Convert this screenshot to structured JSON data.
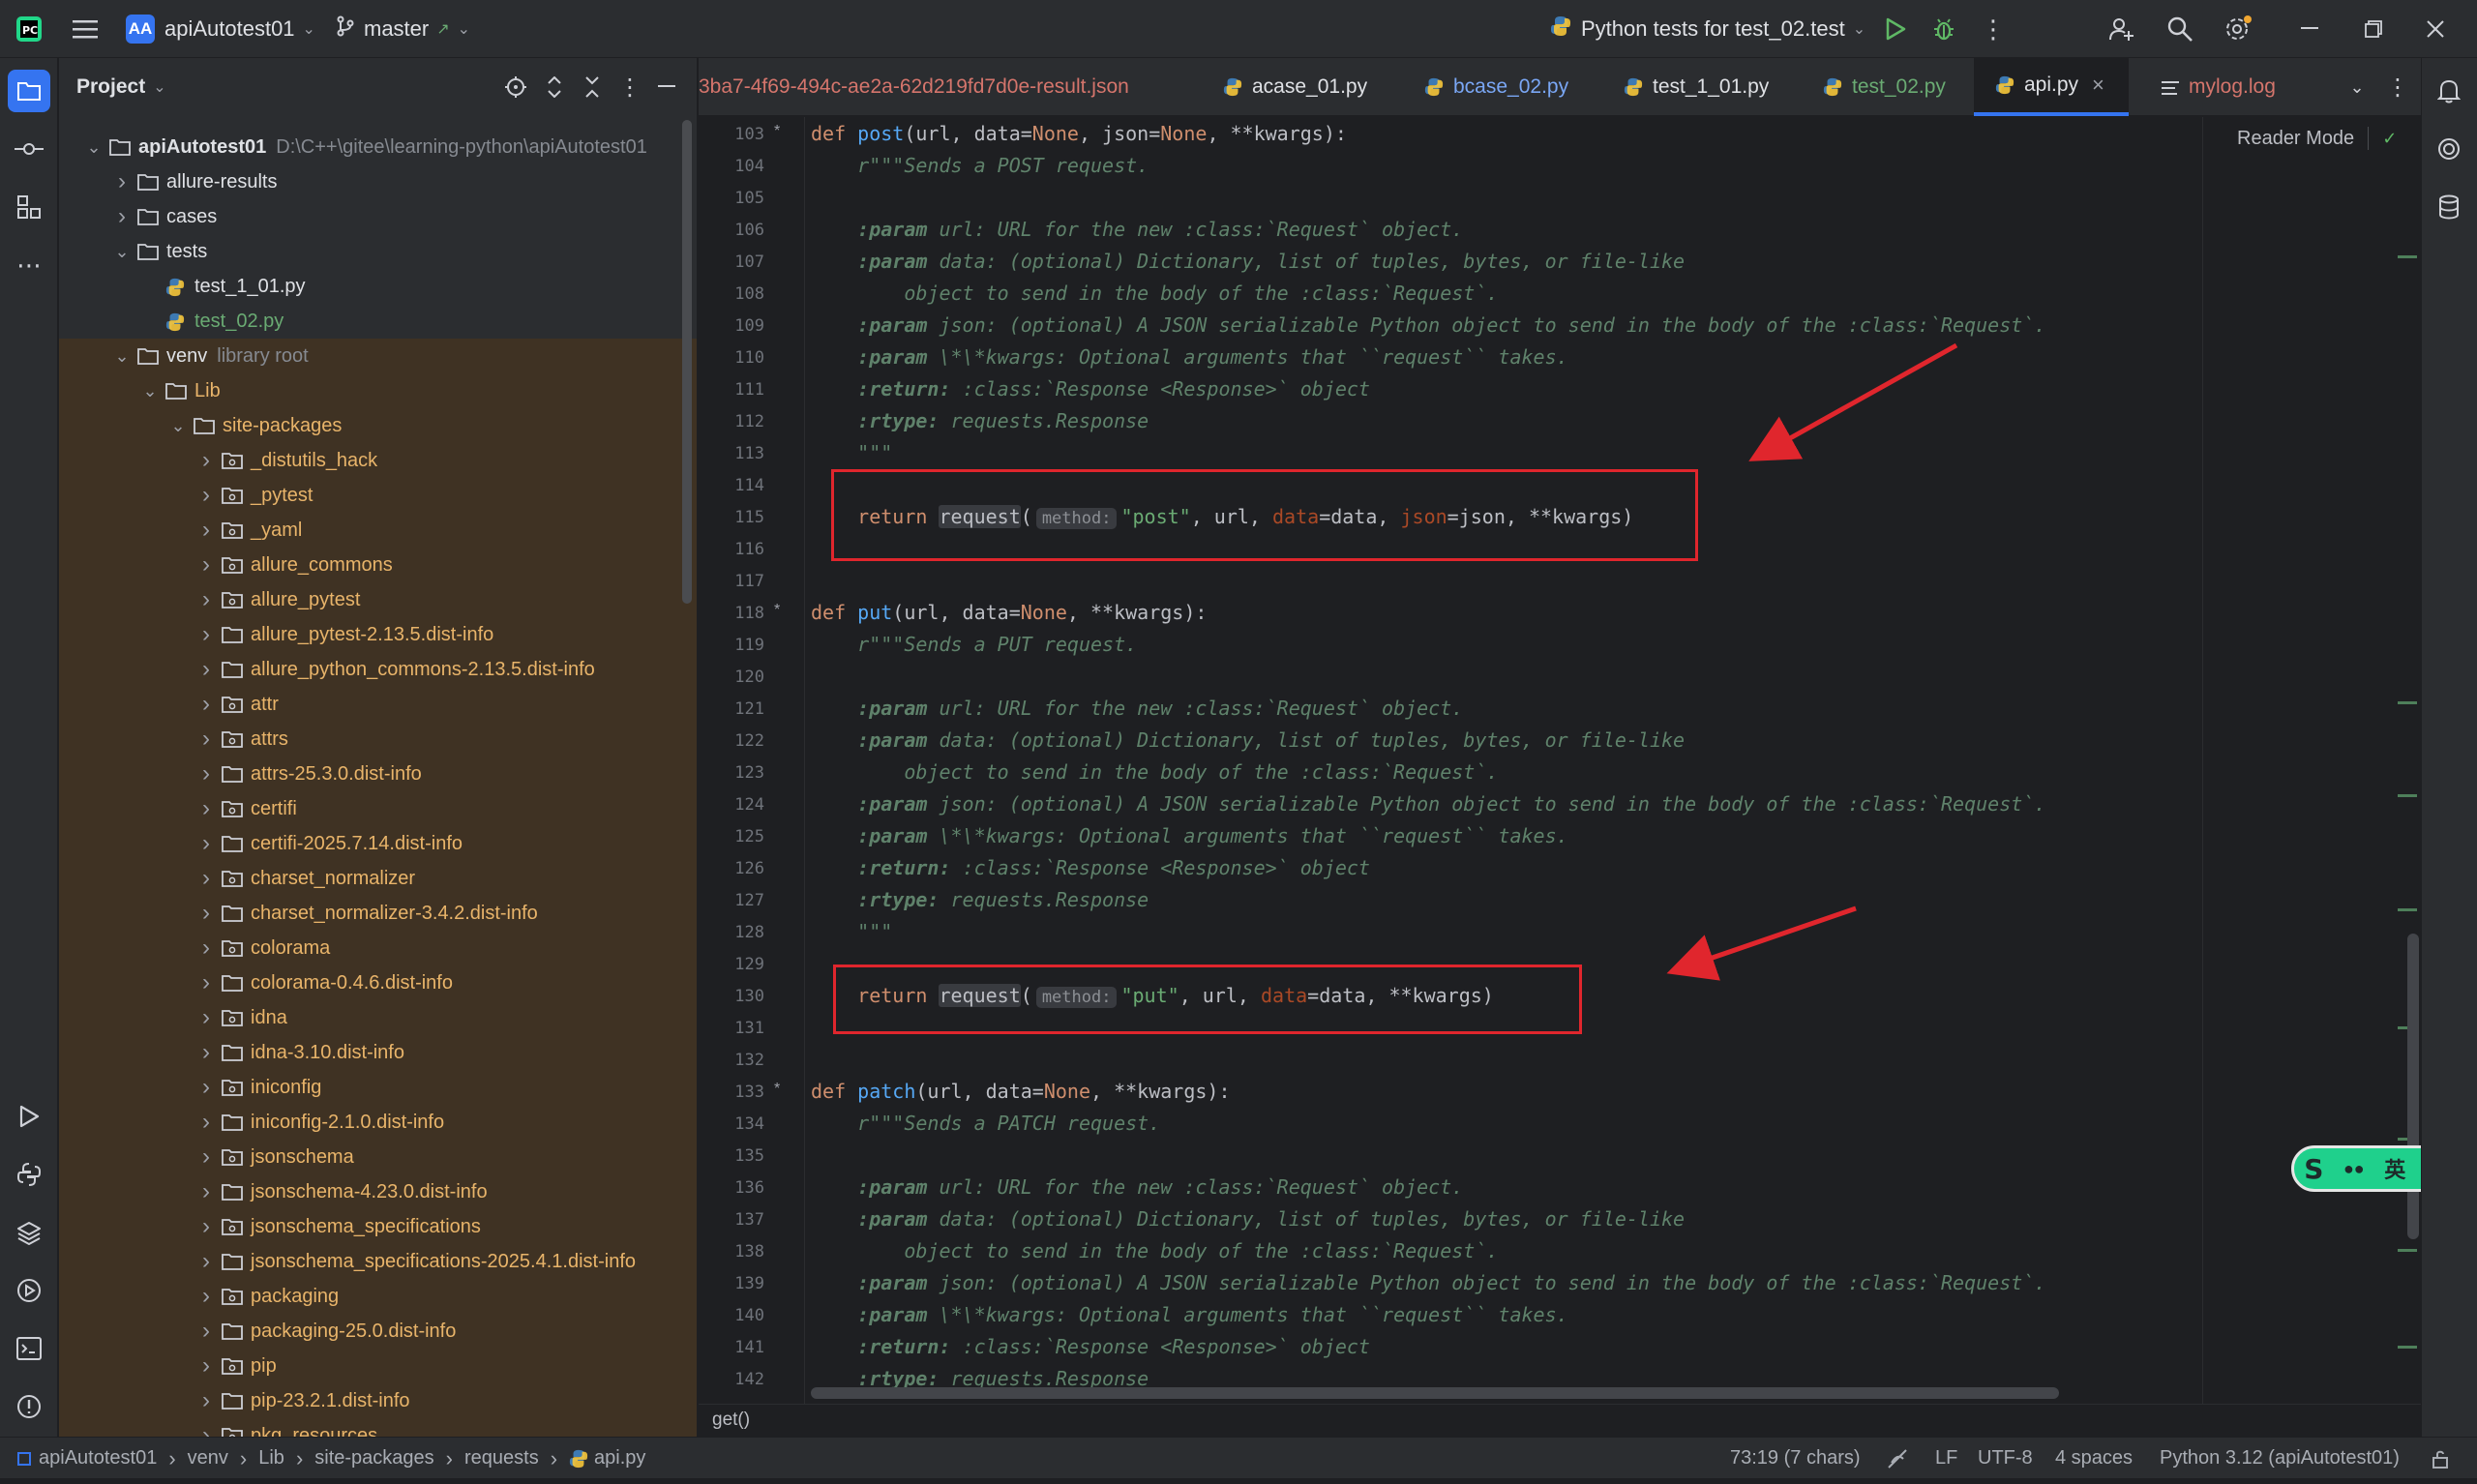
{
  "titlebar": {
    "project_badge": "AA",
    "project_name": "apiAutotest01",
    "branch": "master",
    "run_config": "Python tests for test_02.test"
  },
  "project_panel": {
    "title": "Project",
    "tree": [
      {
        "label": "apiAutotest01",
        "hint": "D:\\C++\\gitee\\learning-python\\apiAutotest01",
        "depth": 0,
        "type": "folder",
        "expanded": true,
        "bold": true
      },
      {
        "label": "allure-results",
        "depth": 1,
        "type": "folder",
        "expanded": false
      },
      {
        "label": "cases",
        "depth": 1,
        "type": "folder",
        "expanded": false
      },
      {
        "label": "tests",
        "depth": 1,
        "type": "folder",
        "expanded": true
      },
      {
        "label": "test_1_01.py",
        "depth": 2,
        "type": "py"
      },
      {
        "label": "test_02.py",
        "depth": 2,
        "type": "py",
        "color": "#6aab73"
      },
      {
        "label": "venv",
        "hint": "library root",
        "depth": 1,
        "type": "folder",
        "expanded": true,
        "venv": true
      },
      {
        "label": "Lib",
        "depth": 2,
        "type": "folder",
        "expanded": true,
        "venv": true
      },
      {
        "label": "site-packages",
        "depth": 3,
        "type": "folder",
        "expanded": true,
        "venv": true
      },
      {
        "label": "_distutils_hack",
        "depth": 4,
        "type": "pkg",
        "venv": true
      },
      {
        "label": "_pytest",
        "depth": 4,
        "type": "pkg",
        "venv": true
      },
      {
        "label": "_yaml",
        "depth": 4,
        "type": "pkg",
        "venv": true
      },
      {
        "label": "allure_commons",
        "depth": 4,
        "type": "pkg",
        "venv": true
      },
      {
        "label": "allure_pytest",
        "depth": 4,
        "type": "pkg",
        "venv": true
      },
      {
        "label": "allure_pytest-2.13.5.dist-info",
        "depth": 4,
        "type": "folder",
        "venv": true
      },
      {
        "label": "allure_python_commons-2.13.5.dist-info",
        "depth": 4,
        "type": "folder",
        "venv": true
      },
      {
        "label": "attr",
        "depth": 4,
        "type": "pkg",
        "venv": true
      },
      {
        "label": "attrs",
        "depth": 4,
        "type": "pkg",
        "venv": true
      },
      {
        "label": "attrs-25.3.0.dist-info",
        "depth": 4,
        "type": "folder",
        "venv": true
      },
      {
        "label": "certifi",
        "depth": 4,
        "type": "pkg",
        "venv": true
      },
      {
        "label": "certifi-2025.7.14.dist-info",
        "depth": 4,
        "type": "folder",
        "venv": true
      },
      {
        "label": "charset_normalizer",
        "depth": 4,
        "type": "pkg",
        "venv": true
      },
      {
        "label": "charset_normalizer-3.4.2.dist-info",
        "depth": 4,
        "type": "folder",
        "venv": true
      },
      {
        "label": "colorama",
        "depth": 4,
        "type": "pkg",
        "venv": true
      },
      {
        "label": "colorama-0.4.6.dist-info",
        "depth": 4,
        "type": "folder",
        "venv": true
      },
      {
        "label": "idna",
        "depth": 4,
        "type": "pkg",
        "venv": true
      },
      {
        "label": "idna-3.10.dist-info",
        "depth": 4,
        "type": "folder",
        "venv": true
      },
      {
        "label": "iniconfig",
        "depth": 4,
        "type": "pkg",
        "venv": true
      },
      {
        "label": "iniconfig-2.1.0.dist-info",
        "depth": 4,
        "type": "folder",
        "venv": true
      },
      {
        "label": "jsonschema",
        "depth": 4,
        "type": "pkg",
        "venv": true
      },
      {
        "label": "jsonschema-4.23.0.dist-info",
        "depth": 4,
        "type": "folder",
        "venv": true
      },
      {
        "label": "jsonschema_specifications",
        "depth": 4,
        "type": "pkg",
        "venv": true
      },
      {
        "label": "jsonschema_specifications-2025.4.1.dist-info",
        "depth": 4,
        "type": "folder",
        "venv": true
      },
      {
        "label": "packaging",
        "depth": 4,
        "type": "pkg",
        "venv": true
      },
      {
        "label": "packaging-25.0.dist-info",
        "depth": 4,
        "type": "folder",
        "venv": true
      },
      {
        "label": "pip",
        "depth": 4,
        "type": "pkg",
        "venv": true
      },
      {
        "label": "pip-23.2.1.dist-info",
        "depth": 4,
        "type": "folder",
        "venv": true
      },
      {
        "label": "pkg_resources",
        "depth": 4,
        "type": "pkg",
        "venv": true
      }
    ]
  },
  "tabs": [
    {
      "label": "3ba7-4f69-494c-ae2a-62d219fd7d0e-result.json",
      "type": "json",
      "color": "#d5756c"
    },
    {
      "label": "acase_01.py",
      "type": "py",
      "color": "#dfe1e5"
    },
    {
      "label": "bcase_02.py",
      "type": "py",
      "color": "#7aa7f5"
    },
    {
      "label": "test_1_01.py",
      "type": "py",
      "color": "#dfe1e5"
    },
    {
      "label": "test_02.py",
      "type": "py",
      "color": "#6aab73"
    },
    {
      "label": "api.py",
      "type": "py",
      "color": "#dfe1e5",
      "active": true
    },
    {
      "label": "mylog.log",
      "type": "log",
      "color": "#d5756c"
    }
  ],
  "editor": {
    "reader_mode": "Reader Mode",
    "lines": [
      {
        "n": "103",
        "fold": "*",
        "html": "<span class='kw'>def </span><span class='fn'>post</span>(url, data=<span class='kw'>None</span>, json=<span class='kw'>None</span>, **kwargs):"
      },
      {
        "n": "104",
        "html": "    <span class='doc'>r\"\"\"Sends a POST request.</span>"
      },
      {
        "n": "105",
        "html": ""
      },
      {
        "n": "106",
        "html": "    <span class='doc'><b>:param</b> url: URL for the new :class:`Request` object.</span>"
      },
      {
        "n": "107",
        "html": "    <span class='doc'><b>:param</b> data: (optional) Dictionary, list of tuples, bytes, or file-like</span>"
      },
      {
        "n": "108",
        "html": "        <span class='doc'>object to send in the body of the :class:`Request`.</span>"
      },
      {
        "n": "109",
        "html": "    <span class='doc'><b>:param</b> json: (optional) A JSON serializable Python object to send in the body of the :class:`Request`.</span>"
      },
      {
        "n": "110",
        "html": "    <span class='doc'><b>:param</b> \\*\\*kwargs: Optional arguments that ``request`` takes.</span>"
      },
      {
        "n": "111",
        "html": "    <span class='doc'><b>:return:</b> :class:`Response &lt;Response&gt;` object</span>"
      },
      {
        "n": "112",
        "html": "    <span class='doc'><b>:rtype:</b> requests.Response</span>"
      },
      {
        "n": "113",
        "html": "    <span class='doc'>\"\"\"</span>"
      },
      {
        "n": "114",
        "html": ""
      },
      {
        "n": "115",
        "html": "    <span class='kw'>return </span><span class='hl-req'>request</span>(<span class='inlay'>method:</span><span class='str'>\"post\"</span>, url, <span class='kwarg'>data</span>=data, <span class='kwarg'>json</span>=json, **kwargs)"
      },
      {
        "n": "116",
        "html": ""
      },
      {
        "n": "117",
        "html": ""
      },
      {
        "n": "118",
        "fold": "*",
        "html": "<span class='kw'>def </span><span class='fn'>put</span>(url, data=<span class='kw'>None</span>, **kwargs):"
      },
      {
        "n": "119",
        "html": "    <span class='doc'>r\"\"\"Sends a PUT request.</span>"
      },
      {
        "n": "120",
        "html": ""
      },
      {
        "n": "121",
        "html": "    <span class='doc'><b>:param</b> url: URL for the new :class:`Request` object.</span>"
      },
      {
        "n": "122",
        "html": "    <span class='doc'><b>:param</b> data: (optional) Dictionary, list of tuples, bytes, or file-like</span>"
      },
      {
        "n": "123",
        "html": "        <span class='doc'>object to send in the body of the :class:`Request`.</span>"
      },
      {
        "n": "124",
        "html": "    <span class='doc'><b>:param</b> json: (optional) A JSON serializable Python object to send in the body of the :class:`Request`.</span>"
      },
      {
        "n": "125",
        "html": "    <span class='doc'><b>:param</b> \\*\\*kwargs: Optional arguments that ``request`` takes.</span>"
      },
      {
        "n": "126",
        "html": "    <span class='doc'><b>:return:</b> :class:`Response &lt;Response&gt;` object</span>"
      },
      {
        "n": "127",
        "html": "    <span class='doc'><b>:rtype:</b> requests.Response</span>"
      },
      {
        "n": "128",
        "html": "    <span class='doc'>\"\"\"</span>"
      },
      {
        "n": "129",
        "html": ""
      },
      {
        "n": "130",
        "html": "    <span class='kw'>return </span><span class='hl-req'>request</span>(<span class='inlay'>method:</span><span class='str'>\"put\"</span>, url, <span class='kwarg'>data</span>=data, **kwargs)"
      },
      {
        "n": "131",
        "html": ""
      },
      {
        "n": "132",
        "html": ""
      },
      {
        "n": "133",
        "fold": "*",
        "html": "<span class='kw'>def </span><span class='fn'>patch</span>(url, data=<span class='kw'>None</span>, **kwargs):"
      },
      {
        "n": "134",
        "html": "    <span class='doc'>r\"\"\"Sends a PATCH request.</span>"
      },
      {
        "n": "135",
        "html": ""
      },
      {
        "n": "136",
        "html": "    <span class='doc'><b>:param</b> url: URL for the new :class:`Request` object.</span>"
      },
      {
        "n": "137",
        "html": "    <span class='doc'><b>:param</b> data: (optional) Dictionary, list of tuples, bytes, or file-like</span>"
      },
      {
        "n": "138",
        "html": "        <span class='doc'>object to send in the body of the :class:`Request`.</span>"
      },
      {
        "n": "139",
        "html": "    <span class='doc'><b>:param</b> json: (optional) A JSON serializable Python object to send in the body of the :class:`Request`.</span>"
      },
      {
        "n": "140",
        "html": "    <span class='doc'><b>:param</b> \\*\\*kwargs: Optional arguments that ``request`` takes.</span>"
      },
      {
        "n": "141",
        "html": "    <span class='doc'><b>:return:</b> :class:`Response &lt;Response&gt;` object</span>"
      },
      {
        "n": "142",
        "html": "    <span class='doc'><b>:rtype:</b> requests.Response</span>"
      }
    ],
    "breadcrumb_function": "get()"
  },
  "statusbar": {
    "path": [
      "apiAutotest01",
      "venv",
      "Lib",
      "site-packages",
      "requests",
      "api.py"
    ],
    "position": "73:19 (7 chars)",
    "line_sep": "LF",
    "encoding": "UTF-8",
    "indent": "4 spaces",
    "interpreter": "Python 3.12 (apiAutotest01)"
  },
  "ime_widget": {
    "lang": "英"
  },
  "colors": {
    "accent": "#3574f0",
    "annotation_red": "#e0262d"
  }
}
